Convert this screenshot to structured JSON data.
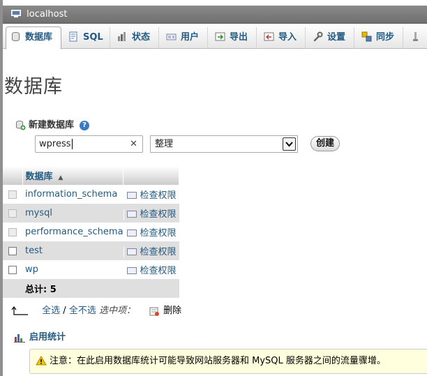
{
  "window": {
    "server_title": "localhost"
  },
  "tabs": [
    {
      "label": "数据库",
      "icon": "database-icon",
      "active": true
    },
    {
      "label": "SQL",
      "icon": "sql-icon"
    },
    {
      "label": "状态",
      "icon": "status-icon"
    },
    {
      "label": "用户",
      "icon": "users-icon"
    },
    {
      "label": "导出",
      "icon": "export-icon"
    },
    {
      "label": "导入",
      "icon": "import-icon"
    },
    {
      "label": "设置",
      "icon": "wrench-icon"
    },
    {
      "label": "同步",
      "icon": "sync-icon"
    }
  ],
  "page": {
    "title": "数据库"
  },
  "create_db": {
    "label": "新建数据库",
    "name_value": "wpress",
    "collation_value": "整理",
    "create_label": "创建"
  },
  "table": {
    "header": "数据库",
    "rows": [
      {
        "name": "information_schema",
        "priv_label": "检查权限",
        "checkbox_disabled": true
      },
      {
        "name": "mysql",
        "priv_label": "检查权限",
        "checkbox_disabled": true
      },
      {
        "name": "performance_schema",
        "priv_label": "检查权限",
        "checkbox_disabled": true
      },
      {
        "name": "test",
        "priv_label": "检查权限",
        "checkbox_disabled": false
      },
      {
        "name": "wp",
        "priv_label": "检查权限",
        "checkbox_disabled": false
      }
    ],
    "total_label": "总计: 5"
  },
  "selection": {
    "select_all": "全选",
    "separator": "/",
    "deselect_all": "全不选",
    "with_selected": "选中项：",
    "drop_label": "删除"
  },
  "stats": {
    "enable_label": "启用统计"
  },
  "notice": {
    "text": "注意：在此启用数据库统计可能导致网站服务器和 MySQL 服务器之间的流量骤增。"
  },
  "colors": {
    "link": "#235a81",
    "server_bar": "#7a7a7a",
    "notice_bg": "#ffffdd"
  }
}
